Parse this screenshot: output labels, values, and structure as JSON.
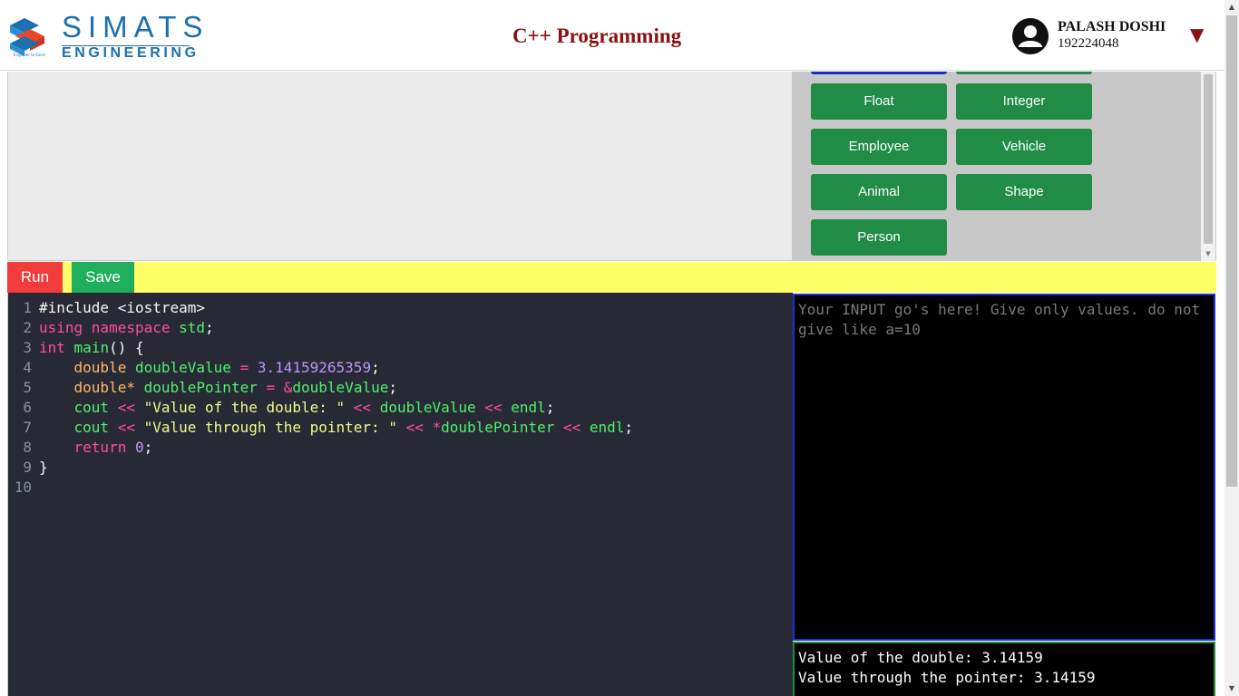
{
  "header": {
    "logo_line1": "SIMATS",
    "logo_line2": "ENGINEERING",
    "logo_tagline": "Engineer to Excel",
    "title": "C++ Programming",
    "user_name": "PALASH DOSHI",
    "user_id": "192224048",
    "caret": "▼"
  },
  "program_buttons": [
    "Float",
    "Integer",
    "Employee",
    "Vehicle",
    "Animal",
    "Shape",
    "Person"
  ],
  "toolbar": {
    "run_label": "Run",
    "save_label": "Save"
  },
  "editor": {
    "line_numbers": [
      "1",
      "2",
      "3",
      "4",
      "5",
      "6",
      "7",
      "8",
      "9",
      "10"
    ],
    "lines": [
      [
        {
          "t": "#include <iostream>",
          "c": "white"
        }
      ],
      [
        {
          "t": "using namespace",
          "c": "pink"
        },
        {
          "t": " ",
          "c": "white"
        },
        {
          "t": "std",
          "c": "green"
        },
        {
          "t": ";",
          "c": "white"
        }
      ],
      [
        {
          "t": "int",
          "c": "pink"
        },
        {
          "t": " ",
          "c": "white"
        },
        {
          "t": "main",
          "c": "green"
        },
        {
          "t": "() {",
          "c": "white"
        }
      ],
      [
        {
          "t": "    ",
          "c": "white"
        },
        {
          "t": "double",
          "c": "orange"
        },
        {
          "t": " ",
          "c": "white"
        },
        {
          "t": "doubleValue",
          "c": "green"
        },
        {
          "t": " = ",
          "c": "pink"
        },
        {
          "t": "3.14159265359",
          "c": "purple"
        },
        {
          "t": ";",
          "c": "white"
        }
      ],
      [
        {
          "t": "    ",
          "c": "white"
        },
        {
          "t": "double*",
          "c": "orange"
        },
        {
          "t": " ",
          "c": "white"
        },
        {
          "t": "doublePointer",
          "c": "green"
        },
        {
          "t": " = ",
          "c": "pink"
        },
        {
          "t": "&",
          "c": "pink"
        },
        {
          "t": "doubleValue",
          "c": "green"
        },
        {
          "t": ";",
          "c": "white"
        }
      ],
      [
        {
          "t": "    ",
          "c": "white"
        },
        {
          "t": "cout",
          "c": "green"
        },
        {
          "t": " << ",
          "c": "pink"
        },
        {
          "t": "\"Value of the double: \"",
          "c": "yellow"
        },
        {
          "t": " << ",
          "c": "pink"
        },
        {
          "t": "doubleValue",
          "c": "green"
        },
        {
          "t": " << ",
          "c": "pink"
        },
        {
          "t": "endl",
          "c": "green"
        },
        {
          "t": ";",
          "c": "white"
        }
      ],
      [
        {
          "t": "    ",
          "c": "white"
        },
        {
          "t": "cout",
          "c": "green"
        },
        {
          "t": " << ",
          "c": "pink"
        },
        {
          "t": "\"Value through the pointer: \"",
          "c": "yellow"
        },
        {
          "t": " << ",
          "c": "pink"
        },
        {
          "t": "*",
          "c": "pink"
        },
        {
          "t": "doublePointer",
          "c": "green"
        },
        {
          "t": " << ",
          "c": "pink"
        },
        {
          "t": "endl",
          "c": "green"
        },
        {
          "t": ";",
          "c": "white"
        }
      ],
      [
        {
          "t": "    ",
          "c": "white"
        },
        {
          "t": "return",
          "c": "pink"
        },
        {
          "t": " ",
          "c": "white"
        },
        {
          "t": "0",
          "c": "purple"
        },
        {
          "t": ";",
          "c": "white"
        }
      ],
      [
        {
          "t": "}",
          "c": "white"
        }
      ],
      []
    ]
  },
  "input": {
    "placeholder": "Your INPUT go's here! Give only values. do not give like a=10"
  },
  "output": {
    "lines": [
      "Value of the double: 3.14159",
      "Value through the pointer: 3.14159"
    ]
  },
  "colors": {
    "button_green": "#218c45",
    "run_red": "#f23c3c",
    "save_green": "#1fae5b",
    "toolbar_yellow": "#ffff66",
    "title_red": "#8b1010",
    "editor_bg": "#272a35",
    "input_border": "#1c2fd6",
    "output_border": "#1e8f3a"
  }
}
